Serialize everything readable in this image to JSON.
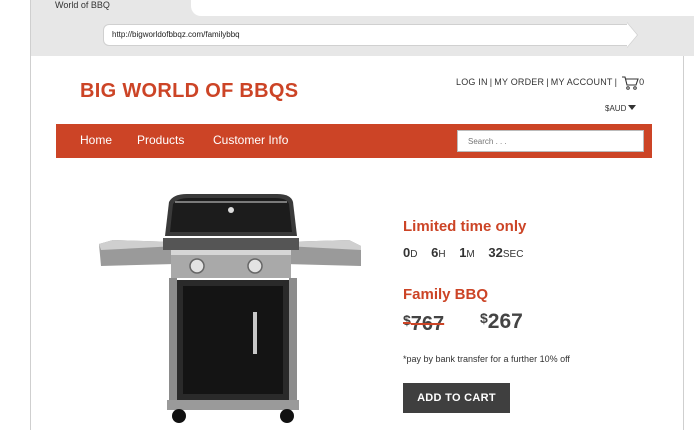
{
  "browser": {
    "tab_title": "World of BBQ",
    "url": "http://bigworldofbbqz.com/familybbq"
  },
  "site": {
    "brand": "BIG WORLD OF BBQS",
    "user_nav": {
      "login": "LOG IN",
      "my_order": "MY ORDER",
      "my_account": "MY ACCOUNT",
      "separator": "|",
      "cart_count": "0",
      "cart_icon": "cart-icon"
    },
    "currency": "$AUD",
    "nav": {
      "home": "Home",
      "products": "Products",
      "customer_info": "Customer Info"
    },
    "search": {
      "placeholder": "Search . . ."
    }
  },
  "product": {
    "promo": "Limited time only",
    "countdown": {
      "days": "0",
      "days_unit": "D",
      "hours": "6",
      "hours_unit": "H",
      "minutes": "1",
      "minutes_unit": "M",
      "seconds": "32",
      "seconds_unit": "SEC"
    },
    "name": "Family BBQ",
    "old_price": {
      "currency": "$",
      "amount": "767"
    },
    "new_price": {
      "currency": "$",
      "amount": "267"
    },
    "note": "*pay by bank transfer for a further 10% off",
    "add_to_cart_label": "ADD TO CART",
    "image_icon": "grill-image"
  },
  "colors": {
    "accent": "#cc4426",
    "button": "#3f3f3f"
  }
}
